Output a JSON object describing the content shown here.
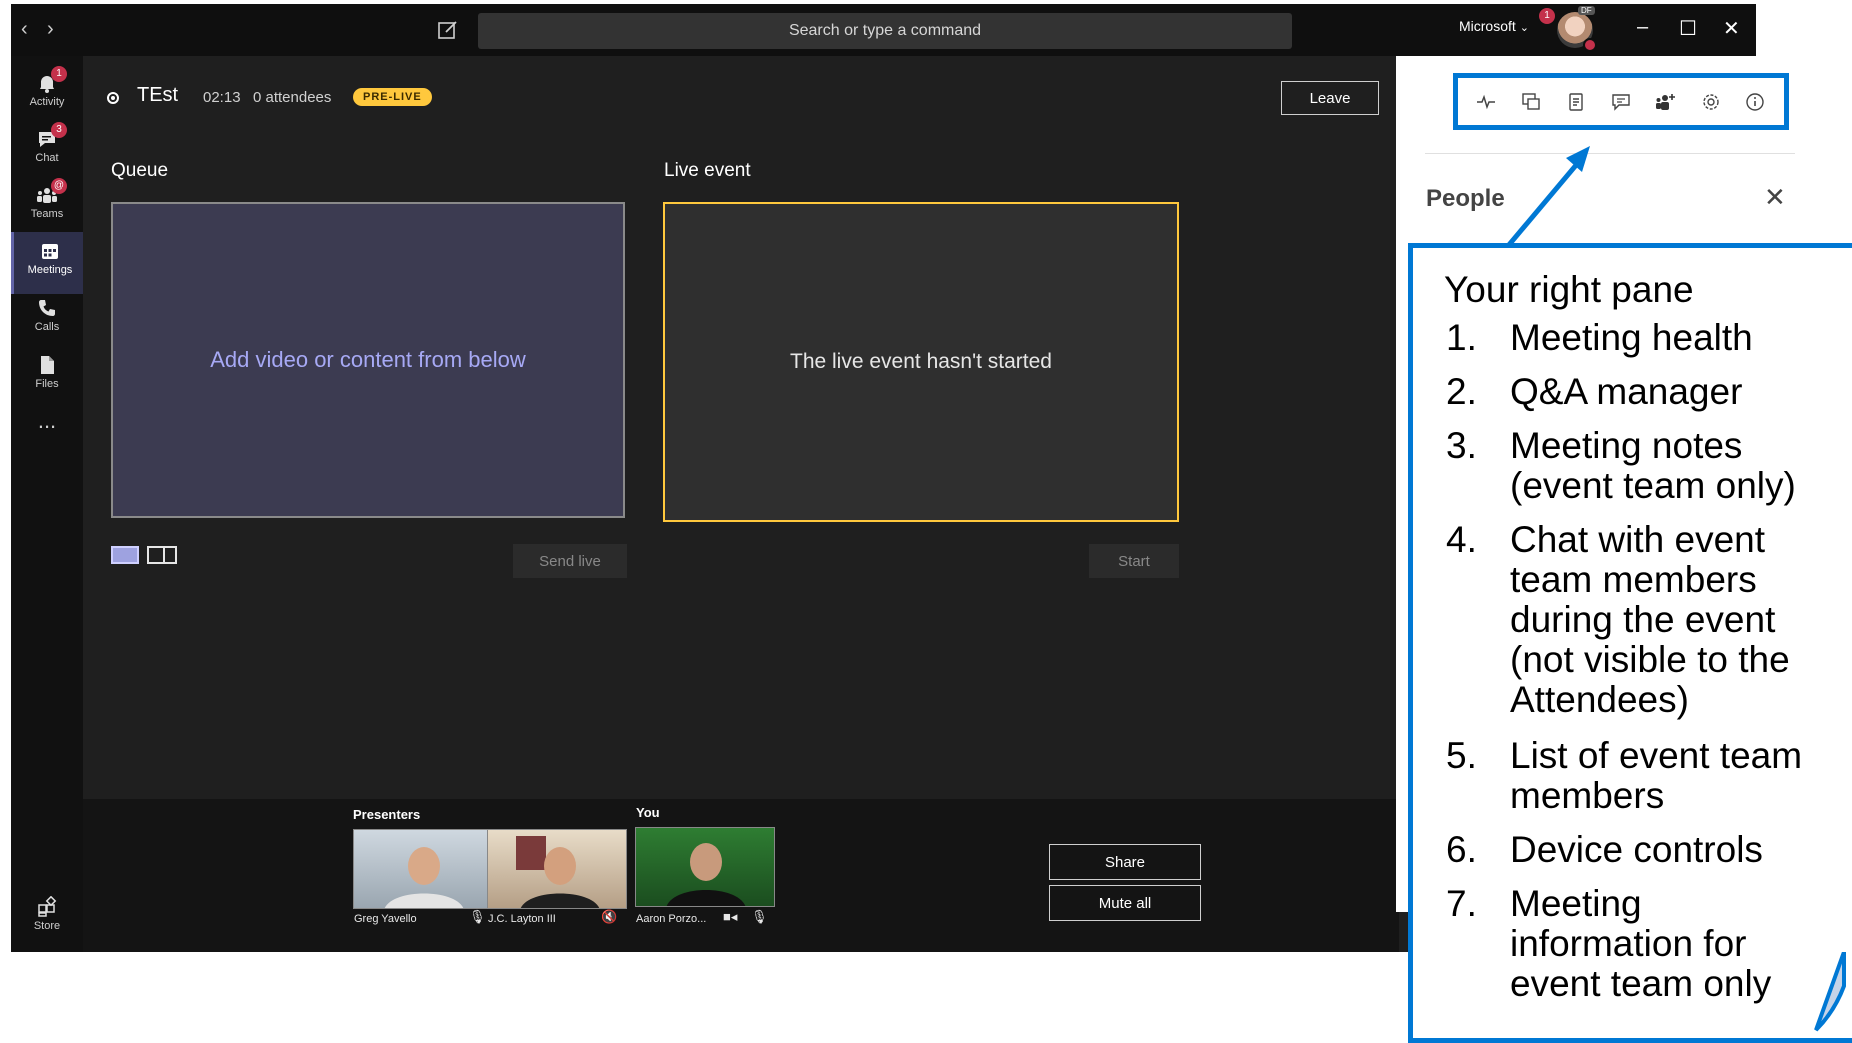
{
  "titlebar": {
    "search_placeholder": "Search or type a command",
    "org_name": "Microsoft",
    "org_badge": "1",
    "avatar_tag": "DF"
  },
  "rail": {
    "items": [
      {
        "label": "Activity",
        "badge": "1"
      },
      {
        "label": "Chat",
        "badge": "3"
      },
      {
        "label": "Teams",
        "badge": "@"
      },
      {
        "label": "Meetings",
        "badge": ""
      },
      {
        "label": "Calls",
        "badge": ""
      },
      {
        "label": "Files",
        "badge": ""
      }
    ],
    "more_label": "...",
    "store_label": "Store"
  },
  "event": {
    "title": "TEst",
    "time": "02:13",
    "attendees": "0 attendees",
    "status_badge": "PRE-LIVE",
    "leave_label": "Leave"
  },
  "queue": {
    "title": "Queue",
    "placeholder": "Add video or content from below",
    "send_live_label": "Send live"
  },
  "live_event": {
    "title": "Live event",
    "message": "The live event hasn't started",
    "start_label": "Start"
  },
  "presenters": {
    "label": "Presenters",
    "people": [
      {
        "name": "Greg Yavello",
        "mic": "on"
      },
      {
        "name": "J.C. Layton III",
        "mic": "muted"
      }
    ]
  },
  "you": {
    "label": "You",
    "name": "Aaron Porzo..."
  },
  "strip_buttons": {
    "share_label": "Share",
    "mute_all_label": "Mute all"
  },
  "right_pane": {
    "title": "People",
    "toolbar_icons": [
      "meeting-health-icon",
      "qa-manager-icon",
      "meeting-notes-icon",
      "chat-icon",
      "team-members-icon",
      "device-settings-icon",
      "info-icon"
    ]
  },
  "callout": {
    "title": "Your right pane",
    "items": [
      {
        "num": "1.",
        "lines": [
          "Meeting health"
        ]
      },
      {
        "num": "2.",
        "lines": [
          "Q&A manager"
        ]
      },
      {
        "num": "3.",
        "lines": [
          "Meeting notes",
          "(event team only)"
        ]
      },
      {
        "num": "4.",
        "lines": [
          "Chat with event",
          "team members",
          "during the event",
          "(not visible to the",
          "Attendees)"
        ]
      },
      {
        "num": "5.",
        "lines": [
          "List of event team",
          "members"
        ]
      },
      {
        "num": "6.",
        "lines": [
          "Device controls"
        ]
      },
      {
        "num": "7.",
        "lines": [
          "Meeting",
          "information for",
          "event team only"
        ]
      }
    ]
  },
  "colors": {
    "accent": "#6264a7",
    "callout_blue": "#0078d4",
    "prelive_yellow": "#ffc83d",
    "badge_red": "#c4314b"
  }
}
